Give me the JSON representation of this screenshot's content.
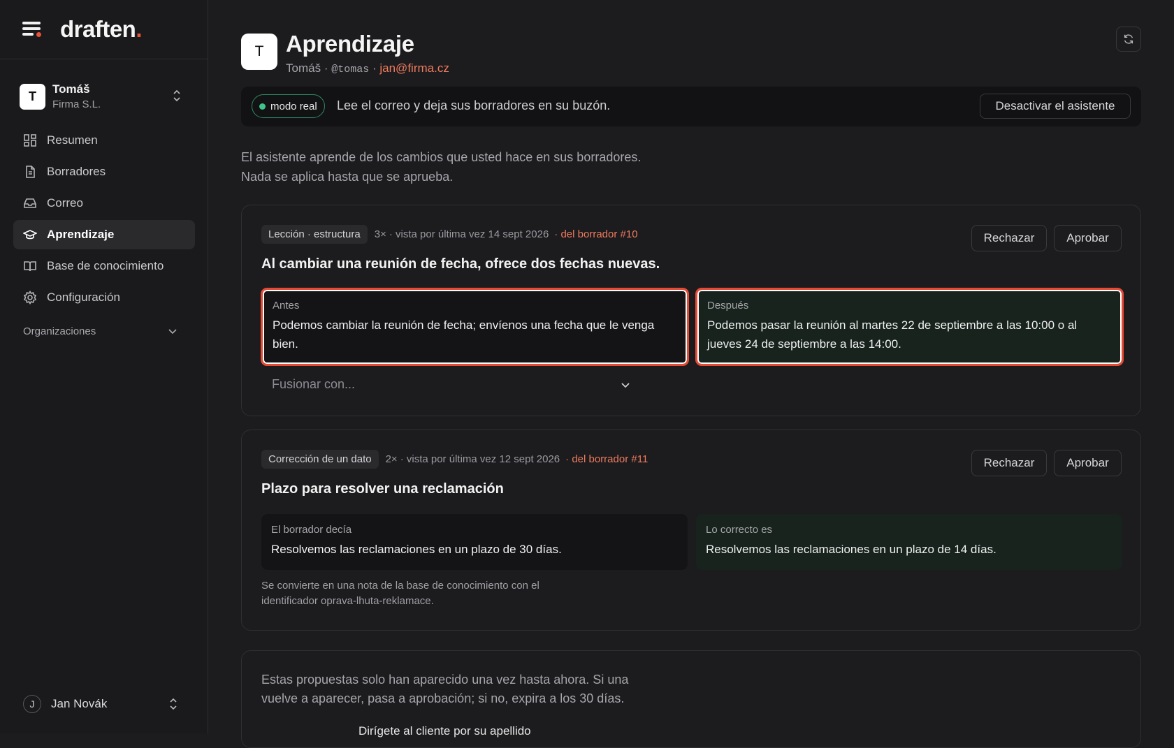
{
  "brand": {
    "name": "draften",
    "dot": "."
  },
  "workspace": {
    "avatar": "T",
    "name": "Tomáš",
    "company": "Firma S.L."
  },
  "nav": [
    {
      "label": "Resumen",
      "icon": "grid-icon"
    },
    {
      "label": "Borradores",
      "icon": "document-icon"
    },
    {
      "label": "Correo",
      "icon": "inbox-icon"
    },
    {
      "label": "Aprendizaje",
      "icon": "graduation-cap-icon",
      "active": true
    },
    {
      "label": "Base de conocimiento",
      "icon": "book-icon"
    },
    {
      "label": "Configuración",
      "icon": "gear-icon"
    }
  ],
  "organizations_label": "Organizaciones",
  "user": {
    "avatar": "J",
    "name": "Jan Novák"
  },
  "header": {
    "avatar": "T",
    "title": "Aprendizaje",
    "name": "Tomáš",
    "sep": "·",
    "handle": "@tomas",
    "email": "jan@firma.cz"
  },
  "status": {
    "mode": "modo real",
    "description": "Lee el correo y deja sus borradores en su buzón.",
    "deactivate": "Desactivar el asistente"
  },
  "intro": {
    "line1": "El asistente aprende de los cambios que usted hace en sus borradores.",
    "line2": "Nada se aplica hasta que se aprueba."
  },
  "lessons": [
    {
      "tag": "Lección · estructura",
      "count": "3×",
      "seen": "· vista por última vez 14 sept 2026",
      "source": "· del borrador #10",
      "title": "Al cambiar una reunión de fecha, ofrece dos fechas nuevas.",
      "before_label": "Antes",
      "before_text": "Podemos cambiar la reunión de fecha; envíenos una fecha que le venga bien.",
      "after_label": "Después",
      "after_text": "Podemos pasar la reunión al martes 22 de septiembre a las 10:00 o al jueves 24 de septiembre a las 14:00.",
      "merge_placeholder": "Fusionar con...",
      "reject": "Rechazar",
      "approve": "Aprobar"
    },
    {
      "tag": "Corrección de un dato",
      "count": "2×",
      "seen": "· vista por última vez 12 sept 2026",
      "source": "· del borrador #11",
      "title": "Plazo para resolver una reclamación",
      "before_label": "El borrador decía",
      "before_text": "Resolvemos las reclamaciones en un plazo de 30 días.",
      "after_label": "Lo correcto es",
      "after_text": "Resolvemos las reclamaciones en un plazo de 14 días.",
      "note_line1": "Se convierte en una nota de la base de conocimiento con el",
      "note_line2": "identificador oprava-lhuta-reklamace.",
      "reject": "Rechazar",
      "approve": "Aprobar"
    }
  ],
  "pending": {
    "line1": "Estas propuestas solo han aparecido una vez hasta ahora. Si una",
    "line2": "vuelve a aparecer, pasa a aprobación; si no, expira a los 30 días.",
    "peek": "Dirígete al cliente por su apellido"
  }
}
